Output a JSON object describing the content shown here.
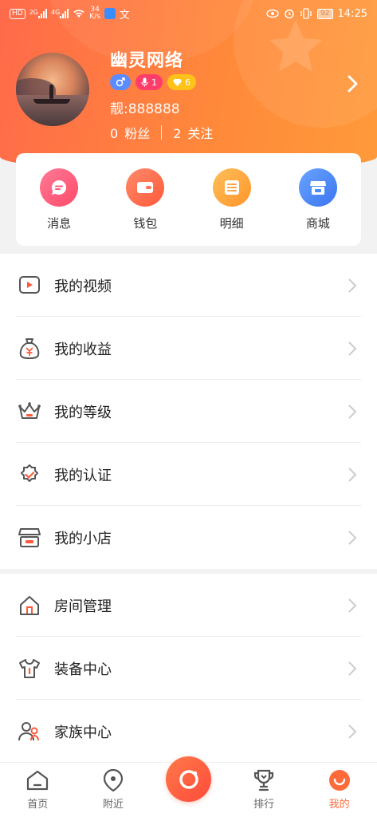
{
  "status_bar": {
    "left_tags": [
      "HD",
      "2G",
      "4G"
    ],
    "speed": "34",
    "speed_unit": "K/s",
    "battery": "92",
    "time": "14:25"
  },
  "profile": {
    "name": "幽灵网络",
    "badge_mic_level": "1",
    "badge_gem_level": "6",
    "beauty_id": "靓:888888",
    "fans_count": "0",
    "fans_label": "粉丝",
    "follow_count": "2",
    "follow_label": "关注"
  },
  "quick_actions": [
    {
      "label": "消息",
      "icon": "message-icon",
      "color": "#ff5d7a"
    },
    {
      "label": "钱包",
      "icon": "wallet-icon",
      "color": "#ff7256"
    },
    {
      "label": "明细",
      "icon": "list-icon",
      "color": "#ffa23a"
    },
    {
      "label": "商城",
      "icon": "shop-icon",
      "color": "#4a8cff"
    }
  ],
  "menu_section_1": [
    {
      "label": "我的视频",
      "icon": "video-icon"
    },
    {
      "label": "我的收益",
      "icon": "money-bag-icon"
    },
    {
      "label": "我的等级",
      "icon": "crown-icon"
    },
    {
      "label": "我的认证",
      "icon": "certified-icon"
    },
    {
      "label": "我的小店",
      "icon": "store-icon"
    }
  ],
  "menu_section_2": [
    {
      "label": "房间管理",
      "icon": "house-icon"
    },
    {
      "label": "装备中心",
      "icon": "shirt-icon"
    },
    {
      "label": "家族中心",
      "icon": "family-icon"
    }
  ],
  "tab_bar": {
    "home": "首页",
    "nearby": "附近",
    "rank": "排行",
    "mine": "我的"
  },
  "colors": {
    "accent": "#ff6a3a",
    "header_start": "#ff6a4a",
    "header_end": "#ff9a3a"
  }
}
